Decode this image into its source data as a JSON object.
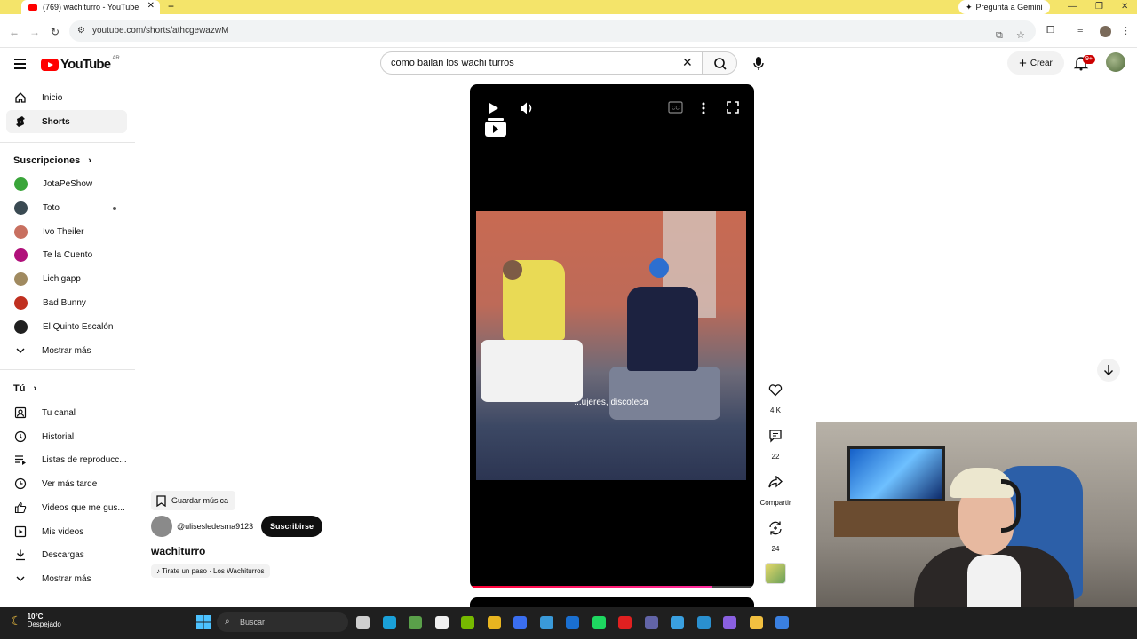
{
  "browser": {
    "tab_title": "(769) wachiturro - YouTube",
    "tab_close": "✕",
    "new_tab": "+",
    "gemini_label": "Pregunta a Gemini",
    "url": "youtube.com/shorts/athcgewazwM"
  },
  "header": {
    "logo_text": "YouTube",
    "country": "AR",
    "search_value": "como bailan los wachi turros",
    "create_label": "Crear",
    "notifications_badge": "9+"
  },
  "sidebar": {
    "primary": [
      {
        "label": "Inicio",
        "icon": "home-icon"
      },
      {
        "label": "Shorts",
        "icon": "shorts-icon",
        "active": true
      }
    ],
    "subscriptions_title": "Suscripciones",
    "subscriptions": [
      {
        "label": "JotaPeShow",
        "color": "#3aa53a"
      },
      {
        "label": "Toto",
        "color": "#3a4a52",
        "new": true
      },
      {
        "label": "Ivo Theiler",
        "color": "#c87060"
      },
      {
        "label": "Te la Cuento",
        "color": "#b0107a"
      },
      {
        "label": "Lichigapp",
        "color": "#a08a60"
      },
      {
        "label": "Bad Bunny",
        "color": "#c03020"
      },
      {
        "label": "El Quinto Escalón",
        "color": "#202020"
      }
    ],
    "subscriptions_more": "Mostrar más",
    "you_title": "Tú",
    "you": [
      {
        "label": "Tu canal",
        "icon": "channel-icon"
      },
      {
        "label": "Historial",
        "icon": "history-icon"
      },
      {
        "label": "Listas de reproducc...",
        "icon": "playlists-icon"
      },
      {
        "label": "Ver más tarde",
        "icon": "watch-later-icon"
      },
      {
        "label": "Videos que me gus...",
        "icon": "like-icon"
      },
      {
        "label": "Mis videos",
        "icon": "my-videos-icon"
      },
      {
        "label": "Descargas",
        "icon": "download-icon"
      },
      {
        "label": "Mostrar más",
        "icon": "chevron-down-icon"
      }
    ]
  },
  "short": {
    "caption": "...ujeres, discoteca",
    "progress": 0.85,
    "save_music": "Guardar música",
    "channel": "@ulisesledesma9123",
    "subscribe": "Suscribirse",
    "title": "wachiturro",
    "sound": "♪ Tirate un paso · Los Wachiturros"
  },
  "actions": {
    "likes": "4 K",
    "comments": "22",
    "share": "Compartir",
    "remix": "24"
  },
  "taskbar": {
    "temperature": "10°C",
    "condition": "Despejado",
    "search_placeholder": "Buscar",
    "apps": [
      {
        "name": "task-view-icon",
        "color": "#cfcfcf"
      },
      {
        "name": "edge-icon",
        "color": "#1aa0d8"
      },
      {
        "name": "minecraft-icon",
        "color": "#5aa04a"
      },
      {
        "name": "capcut-icon",
        "color": "#f0f0f0"
      },
      {
        "name": "nvidia-icon",
        "color": "#76b900"
      },
      {
        "name": "chrome-icon",
        "color": "#e8b520"
      },
      {
        "name": "ea-icon",
        "color": "#3a6ef0"
      },
      {
        "name": "notepad-icon",
        "color": "#3a9ad9"
      },
      {
        "name": "outlook-icon",
        "color": "#1a6fd0"
      },
      {
        "name": "spotify-icon",
        "color": "#1ed760"
      },
      {
        "name": "opera-icon",
        "color": "#e02020"
      },
      {
        "name": "teams-icon",
        "color": "#6264a7"
      },
      {
        "name": "app-icon",
        "color": "#3aa0e0"
      },
      {
        "name": "app2-icon",
        "color": "#2a90d0"
      },
      {
        "name": "copilot-icon",
        "color": "#8a60e0"
      },
      {
        "name": "explorer-icon",
        "color": "#f2c040"
      },
      {
        "name": "store-icon",
        "color": "#3a80e0"
      }
    ]
  },
  "colors": {
    "brand_red": "#ff0000",
    "tabstrip": "#f4e46a"
  }
}
